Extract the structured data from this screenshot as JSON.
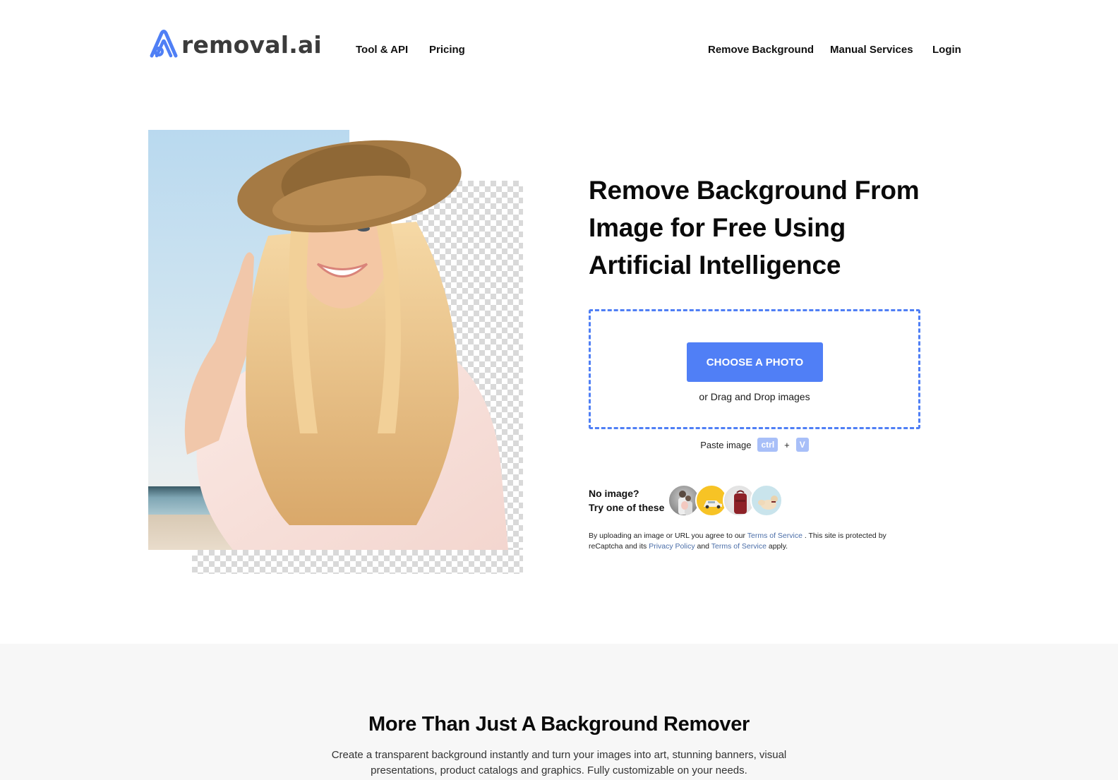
{
  "header": {
    "logo_text": "removal.ai",
    "brand_color": "#4f7ff5",
    "nav_left": [
      {
        "label": "Tool & API"
      },
      {
        "label": "Pricing"
      }
    ],
    "nav_right": [
      {
        "label": "Remove Background"
      },
      {
        "label": "Manual Services"
      },
      {
        "label": "Login"
      }
    ]
  },
  "hero": {
    "image_alt": "Smiling woman in straw hat with background partially removed",
    "title": "Remove Background From Image for Free Using Artificial Intelligence",
    "upload": {
      "button_label": "CHOOSE A PHOTO",
      "drag_text": "or Drag and Drop images"
    },
    "paste": {
      "label": "Paste image",
      "key1": "ctrl",
      "plus": "+",
      "key2": "V"
    },
    "samples": {
      "line1": "No image?",
      "line2": "Try one of these",
      "items": [
        {
          "name": "family-photo"
        },
        {
          "name": "car-photo"
        },
        {
          "name": "backpack-photo"
        },
        {
          "name": "dog-photo"
        }
      ]
    },
    "legal": {
      "part1": "By uploading an image or URL you agree to our ",
      "tos_link": "Terms of Service",
      "part2": " . This site is protected by reCaptcha and its ",
      "privacy_link": "Privacy Policy",
      "part3": " and ",
      "tos_link2": "Terms of Service",
      "part4": " apply."
    }
  },
  "section2": {
    "title": "More Than Just A Background Remover",
    "description": "Create a transparent background instantly and turn your images into art, stunning banners, visual presentations, product catalogs and graphics. Fully customizable on your needs."
  }
}
